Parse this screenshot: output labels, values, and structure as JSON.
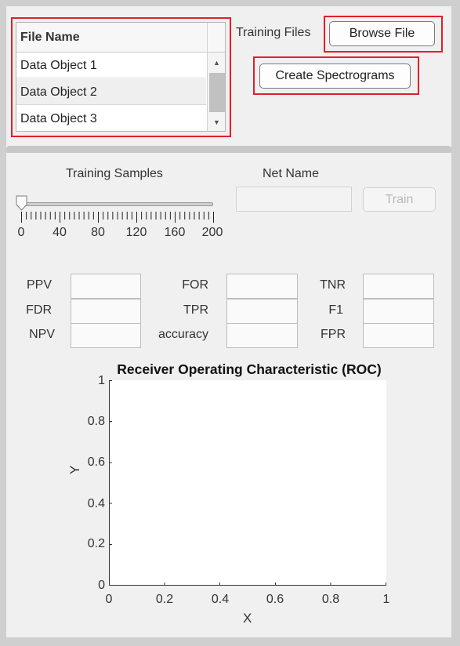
{
  "file_table": {
    "header": "File Name",
    "rows": [
      "Data Object 1",
      "Data Object 2",
      "Data Object 3"
    ]
  },
  "training_files_label": "Training Files",
  "browse_button": "Browse File",
  "create_spectrograms_button": "Create Spectrograms",
  "training_samples": {
    "label": "Training Samples",
    "value": 0,
    "min": 0,
    "max": 200,
    "tick_labels": [
      "0",
      "40",
      "80",
      "120",
      "160",
      "200"
    ]
  },
  "net_name": {
    "label": "Net Name",
    "value": ""
  },
  "train_button": "Train",
  "metrics": {
    "col1": [
      "PPV",
      "FDR",
      "NPV"
    ],
    "col2": [
      "FOR",
      "TPR",
      "accuracy"
    ],
    "col3": [
      "TNR",
      "F1",
      "FPR"
    ]
  },
  "plot": {
    "title": "Receiver Operating Characteristic (ROC)",
    "xlabel": "X",
    "ylabel": "Y",
    "xticks": [
      "0",
      "0.2",
      "0.4",
      "0.6",
      "0.8",
      "1"
    ],
    "yticks": [
      "0",
      "0.2",
      "0.4",
      "0.6",
      "0.8",
      "1"
    ]
  },
  "colors": {
    "highlight": "#e0202a",
    "panel": "#f0f0f0"
  }
}
